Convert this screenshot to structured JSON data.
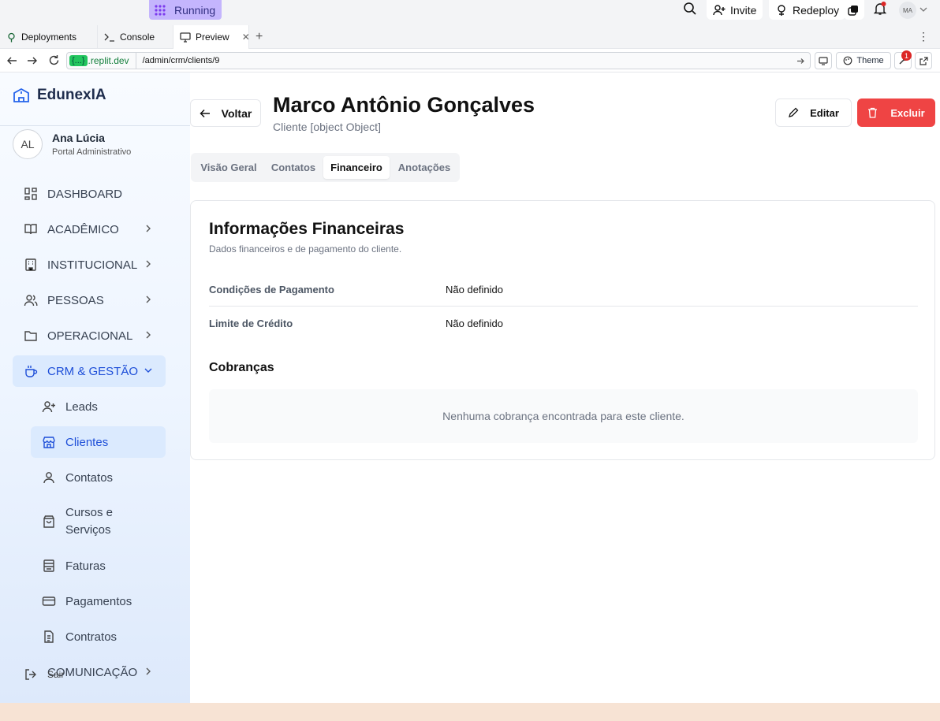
{
  "replit": {
    "run_status": "Running",
    "invite_label": "Invite",
    "redeploy_label": "Redeploy",
    "avatar_initials": "MA",
    "tabs": [
      {
        "label": "Deployments"
      },
      {
        "label": "Console"
      },
      {
        "label": "Preview"
      }
    ],
    "url_host": ".replit.dev",
    "url_path": "/admin/crm/clients/9",
    "theme_label": "Theme",
    "notification_count": "1"
  },
  "sidebar": {
    "brand": "EdunexIA",
    "user": {
      "initials": "AL",
      "name": "Ana Lúcia",
      "role": "Portal Administrativo"
    },
    "items": [
      {
        "label": "DASHBOARD",
        "icon": "dashboard-icon"
      },
      {
        "label": "ACADÊMICO",
        "icon": "book-icon"
      },
      {
        "label": "INSTITUCIONAL",
        "icon": "building-icon"
      },
      {
        "label": "PESSOAS",
        "icon": "users-icon"
      },
      {
        "label": "OPERACIONAL",
        "icon": "folder-icon"
      },
      {
        "label": "CRM & GESTÃO",
        "icon": "coffee-icon"
      },
      {
        "label": "COMUNICAÇÃO",
        "icon": "chat-icon"
      }
    ],
    "subitems": [
      {
        "label": "Leads"
      },
      {
        "label": "Clientes"
      },
      {
        "label": "Contatos"
      },
      {
        "label": "Cursos e Serviços"
      },
      {
        "label": "Faturas"
      },
      {
        "label": "Pagamentos"
      },
      {
        "label": "Contratos"
      }
    ],
    "logout_label": "Sair"
  },
  "page": {
    "back_label": "Voltar",
    "title": "Marco Antônio Gonçalves",
    "subtitle": "Cliente [object Object]",
    "edit_label": "Editar",
    "delete_label": "Excluir",
    "tabs": [
      {
        "label": "Visão Geral"
      },
      {
        "label": "Contatos"
      },
      {
        "label": "Financeiro"
      },
      {
        "label": "Anotações"
      }
    ],
    "active_tab": "Financeiro"
  },
  "finance": {
    "title": "Informações Financeiras",
    "description": "Dados financeiros e de pagamento do cliente.",
    "rows": [
      {
        "label": "Condições de Pagamento",
        "value": "Não definido"
      },
      {
        "label": "Limite de Crédito",
        "value": "Não definido"
      }
    ],
    "charges_title": "Cobranças",
    "charges_empty": "Nenhuma cobrança encontrada para este cliente."
  },
  "colors": {
    "accent": "#2563eb",
    "danger": "#ef4444",
    "active_nav_bg": "#dbeafe"
  }
}
